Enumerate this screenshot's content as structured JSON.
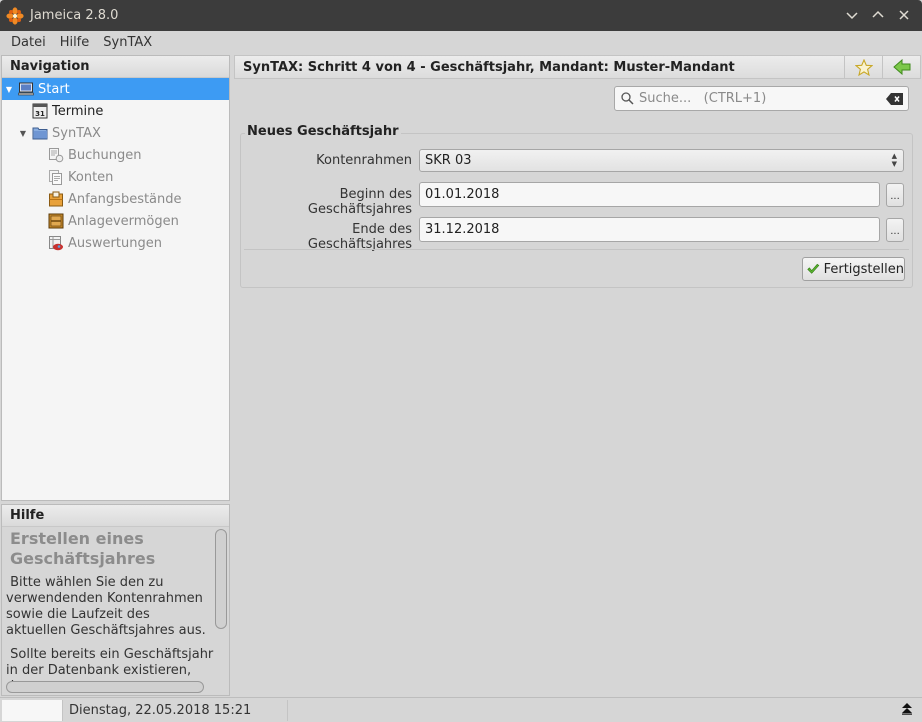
{
  "window": {
    "title": "Jameica 2.8.0",
    "controls": [
      "minimize",
      "maximize",
      "close"
    ]
  },
  "menubar": {
    "items": [
      {
        "label": "Datei"
      },
      {
        "label": "Hilfe"
      },
      {
        "label": "SynTAX"
      }
    ]
  },
  "navigation": {
    "header": "Navigation",
    "items": [
      {
        "label": "Start",
        "icon": "monitor-icon",
        "selected": true,
        "expanded": true,
        "level": 0
      },
      {
        "label": "Termine",
        "icon": "calendar-icon",
        "level": 1
      },
      {
        "label": "SynTAX",
        "icon": "folder-icon",
        "expanded": true,
        "level": 1
      },
      {
        "label": "Buchungen",
        "icon": "bookings-icon",
        "level": 2,
        "disabled": true
      },
      {
        "label": "Konten",
        "icon": "accounts-icon",
        "level": 2,
        "disabled": true
      },
      {
        "label": "Anfangsbestände",
        "icon": "opening-balance-icon",
        "level": 2,
        "disabled": true
      },
      {
        "label": "Anlagevermögen",
        "icon": "cabinet-icon",
        "level": 2,
        "disabled": true
      },
      {
        "label": "Auswertungen",
        "icon": "reports-icon",
        "level": 2,
        "disabled": true
      }
    ]
  },
  "help": {
    "header": "Hilfe",
    "title": "Erstellen eines Geschäftsjahres",
    "paragraphs": [
      "Bitte wählen Sie den zu verwendenden Kontenrahmen sowie die Laufzeit des aktuellen Geschäftsjahres aus.",
      "Sollte bereits ein Geschäftsjahr in der Datenbank existieren, dann"
    ]
  },
  "main": {
    "title": "SynTAX: Schritt 4 von 4 - Geschäftsjahr, Mandant: Muster-Mandant",
    "search": {
      "placeholder": "Suche...   (CTRL+1)",
      "value": ""
    },
    "group_title": "Neues Geschäftsjahr",
    "fields": {
      "kontenrahmen": {
        "label": "Kontenrahmen",
        "value": "SKR 03"
      },
      "beginn": {
        "label": "Beginn des Geschäftsjahres",
        "value": "01.01.2018"
      },
      "ende": {
        "label": "Ende des Geschäftsjahres",
        "value": "31.12.2018"
      }
    },
    "picker_label": "...",
    "finish_label": "Fertigstellen"
  },
  "status": {
    "datetime": "Dienstag, 22.05.2018 15:21"
  },
  "colors": {
    "selection": "#3d9bf3",
    "titlebar": "#3c3c3c",
    "accent_green": "#5cb531"
  }
}
